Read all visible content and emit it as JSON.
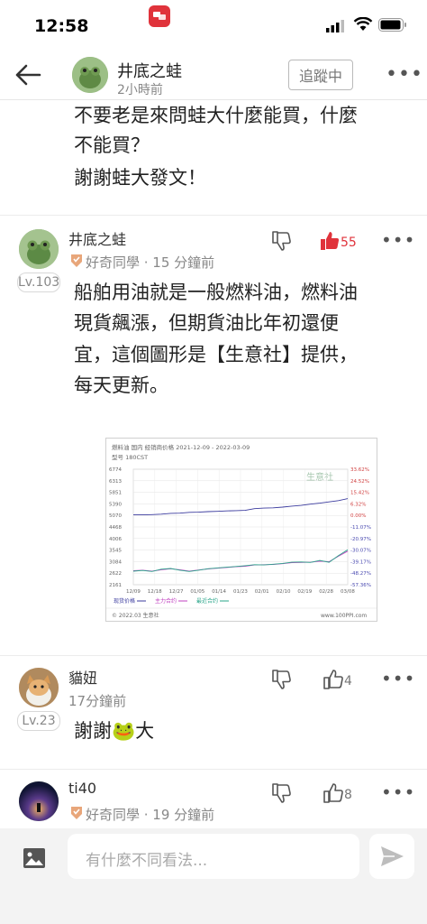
{
  "status_bar": {
    "time": "12:58"
  },
  "header": {
    "author": "井底之蛙",
    "time": "2小時前",
    "follow_label": "追蹤中"
  },
  "post_tail": {
    "lines": [
      "不要老是來問蛙大什麼能買，什麼",
      "不能買？",
      "謝謝蛙大發文！"
    ]
  },
  "comments": [
    {
      "name": "井底之蛙",
      "level": "Lv.103",
      "meta": "好奇同學 · 15 分鐘前",
      "likes": "55",
      "text_lines": [
        "船舶用油就是一般燃料油，燃料油",
        "現貨飆漲，但期貨油比年初還便",
        "宜，這個圖形是【生意社】提供，",
        "每天更新。"
      ]
    },
    {
      "name": "貓妞",
      "level": "Lv.23",
      "meta": "17分鐘前",
      "likes": "4",
      "text_before": "謝謝",
      "text_emoji": "🐸",
      "text_after": "大"
    },
    {
      "name": "ti40",
      "meta": "好奇同學 · 19 分鐘前",
      "likes": "8"
    }
  ],
  "input": {
    "placeholder": "有什麼不同看法..."
  },
  "chart_data": {
    "type": "line",
    "title": "燃料油  国内  经销商价格   2021-12-09 - 2022-03-09",
    "subtitle": "型号 180CST",
    "watermark": "生意社",
    "footer_left": "© 2022.03 生意社",
    "footer_right": "www.100PPI.com",
    "left_ticks": [
      "6774",
      "6313",
      "5851",
      "5390",
      "5070",
      "4468",
      "4006",
      "3545",
      "3084",
      "2622",
      "2161"
    ],
    "right_ticks": [
      "33.62%",
      "24.52%",
      "15.42%",
      "6.32%",
      "0.00%",
      "-11.07%",
      "-20.97%",
      "-30.07%",
      "-39.17%",
      "-48.27%",
      "-57.36%"
    ],
    "x_labels": [
      "12/09",
      "12/18",
      "12/27",
      "01/05",
      "01/14",
      "01/23",
      "02/01",
      "02/10",
      "02/19",
      "02/28",
      "03/08"
    ],
    "legend": [
      "现货价格",
      "主力合约",
      "最近合约"
    ],
    "series": [
      {
        "name": "现货价格",
        "color": "#3b3b9e",
        "values": [
          4950,
          4950,
          4960,
          4980,
          5010,
          5020,
          5050,
          5060,
          5080,
          5090,
          5110,
          5120,
          5130,
          5200,
          5220,
          5230,
          5260,
          5300,
          5330,
          5380,
          5420,
          5470,
          5520,
          5600
        ]
      },
      {
        "name": "主力合约",
        "color": "#c040c0",
        "values": [
          2720,
          2740,
          2700,
          2760,
          2800,
          2760,
          2700,
          2750,
          2790,
          2820,
          2850,
          2880,
          2900,
          2950,
          2960,
          2970,
          3000,
          3040,
          3050,
          3060,
          3100,
          3080,
          3300,
          3500
        ]
      },
      {
        "name": "最近合约",
        "color": "#2aa58a",
        "values": [
          2700,
          2730,
          2690,
          2780,
          2810,
          2740,
          2690,
          2740,
          2800,
          2830,
          2860,
          2890,
          2920,
          2960,
          2950,
          2980,
          3010,
          3060,
          3070,
          3050,
          3130,
          3060,
          3320,
          3560
        ]
      }
    ],
    "ylim": [
      2161,
      6774
    ]
  },
  "colors": {
    "accent_red": "#e0333b"
  }
}
